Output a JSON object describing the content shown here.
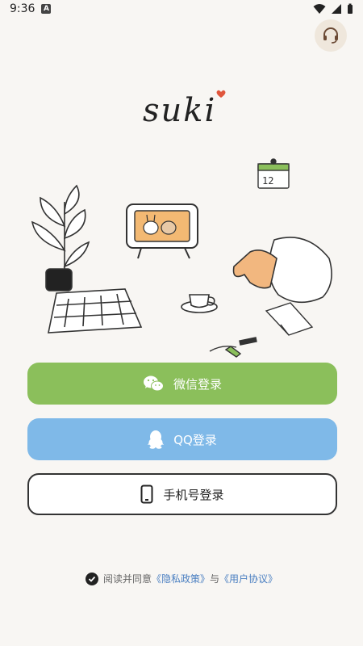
{
  "status_bar": {
    "time": "9:36",
    "notification_letter": "A"
  },
  "logo_text": "suki",
  "buttons": {
    "wechat": "微信登录",
    "qq": "QQ登录",
    "phone": "手机号登录"
  },
  "agreement": {
    "prefix": "阅读并同意",
    "privacy_link": "《隐私政策》",
    "connector": "与",
    "user_link": "《用户协议》"
  },
  "calendar_number": "12",
  "colors": {
    "background": "#f8f6f3",
    "wechat_green": "#8bbf5b",
    "qq_blue": "#7fb9e8",
    "link_blue": "#4a7fc1"
  }
}
